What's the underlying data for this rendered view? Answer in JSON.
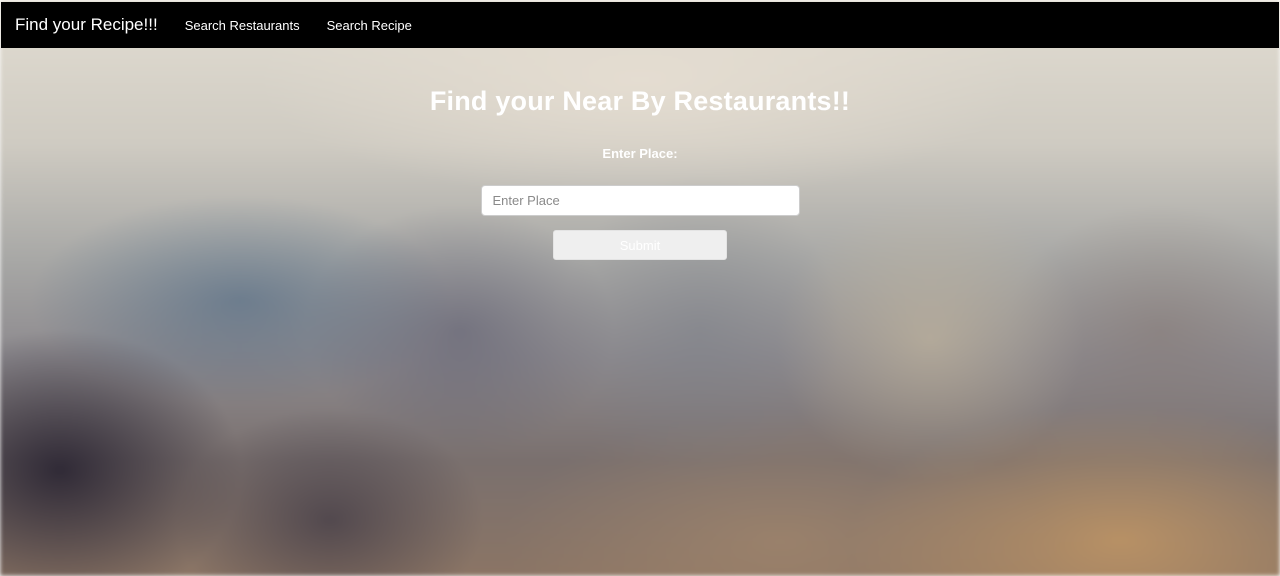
{
  "navbar": {
    "brand": "Find your Recipe!!!",
    "links": [
      "Search Restaurants",
      "Search Recipe"
    ],
    "background_color": "#000000"
  },
  "main": {
    "title": "Find your Near By Restaurants!!",
    "field_label": "Enter Place:",
    "place_input": {
      "value": "",
      "placeholder": "Enter Place"
    },
    "submit_label": "Submit"
  }
}
